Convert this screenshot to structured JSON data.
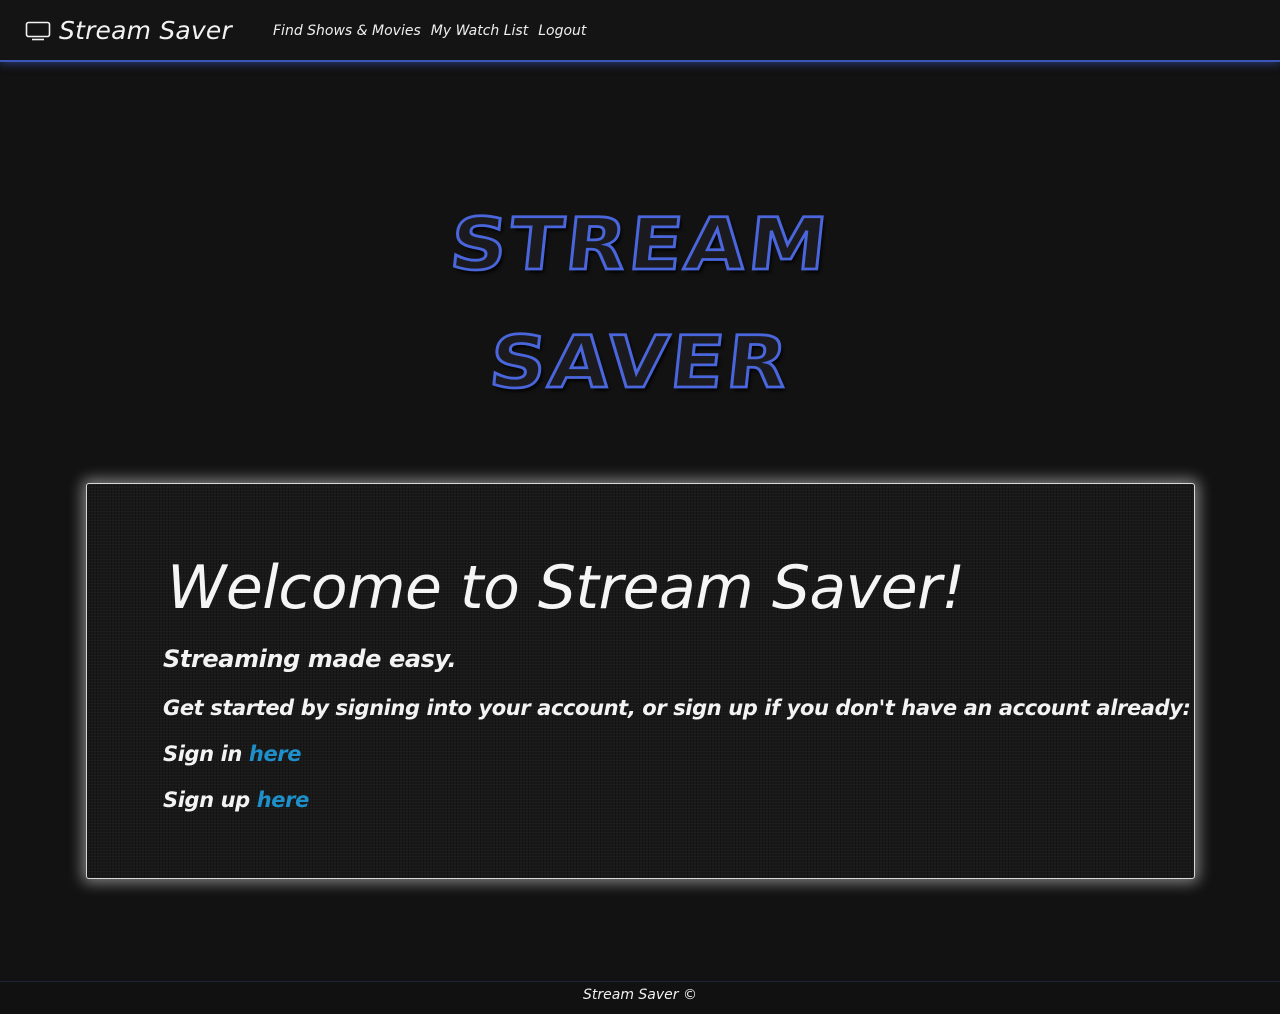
{
  "navbar": {
    "brand": "Stream Saver",
    "brand_icon": "tv-icon",
    "links": [
      {
        "label": "Find Shows & Movies"
      },
      {
        "label": "My Watch List"
      },
      {
        "label": "Logout"
      }
    ],
    "accent_color": "#3b55b8"
  },
  "hero": {
    "logo_line_1": "STREAM",
    "logo_line_2": "SAVER",
    "logo_outline_color": "#4a66dd"
  },
  "card": {
    "title": "Welcome to Stream Saver!",
    "tagline": "Streaming made easy.",
    "intro": "Get started by signing into your account, or sign up if you don't have an account already:",
    "signin_prefix": "Sign in",
    "signin_link": "here",
    "signup_prefix": "Sign up",
    "signup_link": "here",
    "link_color": "#1f8fc9"
  },
  "footer": {
    "text": "Stream Saver ©"
  }
}
